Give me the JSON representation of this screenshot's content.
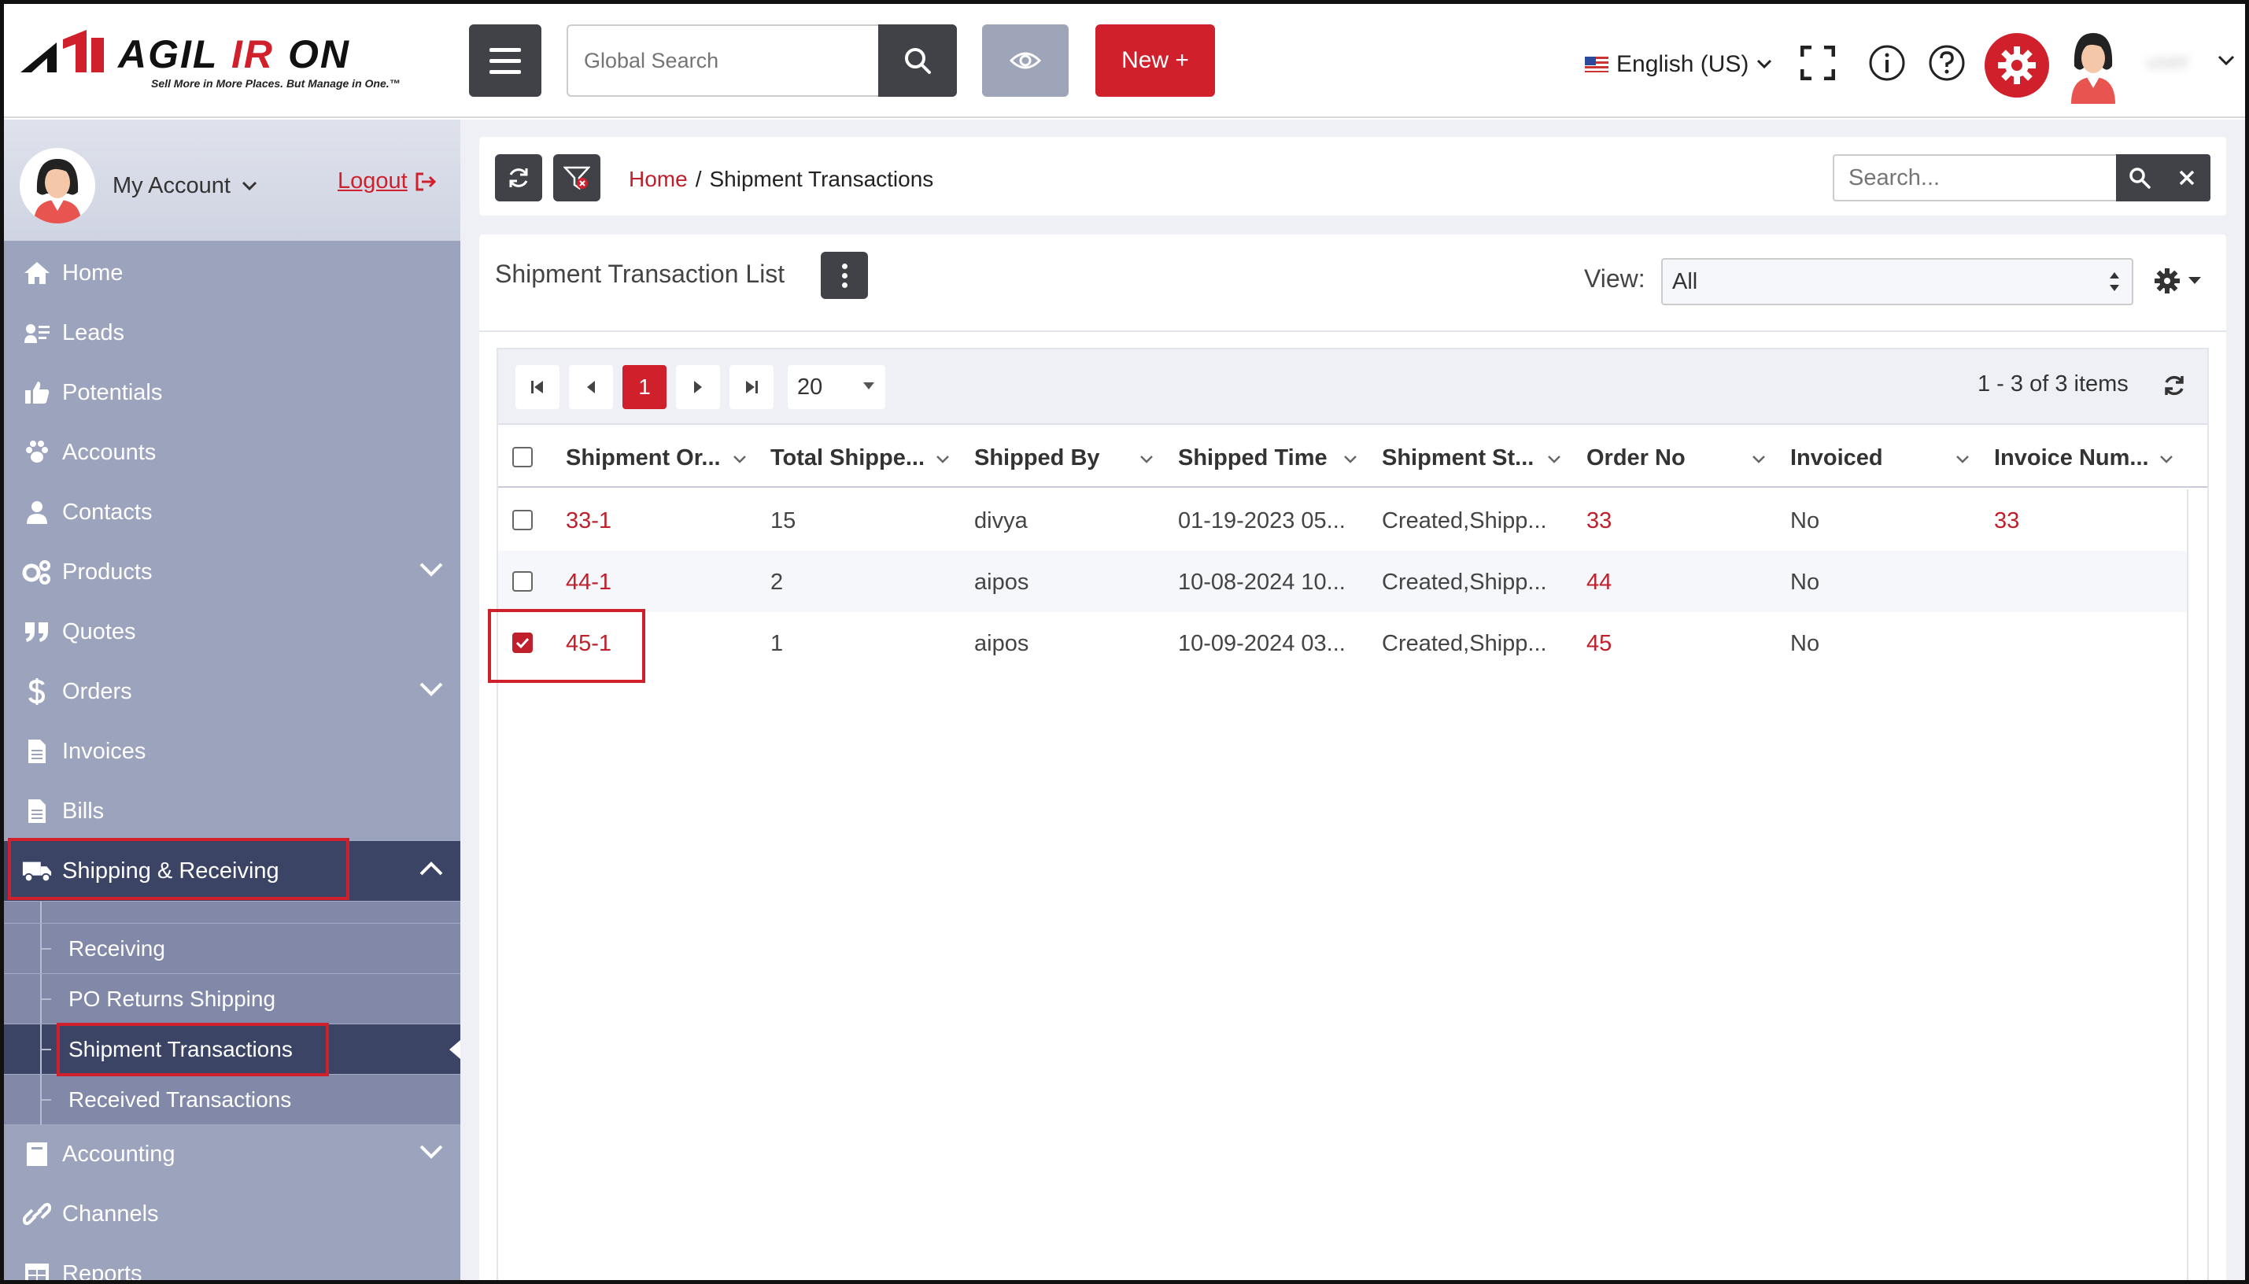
{
  "brand": {
    "logo_text": "AGILIRON",
    "tagline": "Sell More in More Places. But Manage in One.™"
  },
  "topbar": {
    "search_placeholder": "Global Search",
    "new_label": "New +",
    "language": "English (US)"
  },
  "sidebar": {
    "account_label": "My Account",
    "logout_label": "Logout",
    "items": [
      {
        "label": "Home",
        "icon": "home-icon"
      },
      {
        "label": "Leads",
        "icon": "leads-icon"
      },
      {
        "label": "Potentials",
        "icon": "thumbs-up-icon"
      },
      {
        "label": "Accounts",
        "icon": "paw-icon"
      },
      {
        "label": "Contacts",
        "icon": "user-icon"
      },
      {
        "label": "Products",
        "icon": "cogs-icon"
      },
      {
        "label": "Quotes",
        "icon": "quote-icon"
      },
      {
        "label": "Orders",
        "icon": "dollar-icon"
      },
      {
        "label": "Invoices",
        "icon": "document-icon"
      },
      {
        "label": "Bills",
        "icon": "document-icon"
      },
      {
        "label": "Shipping & Receiving",
        "icon": "truck-icon"
      },
      {
        "label": "Accounting",
        "icon": "book-icon"
      },
      {
        "label": "Channels",
        "icon": "link-icon"
      },
      {
        "label": "Reports",
        "icon": "table-icon"
      }
    ],
    "sub_items": [
      {
        "label": "Receiving"
      },
      {
        "label": "PO Returns Shipping"
      },
      {
        "label": "Shipment Transactions"
      },
      {
        "label": "Received Transactions"
      }
    ]
  },
  "breadcrumb": {
    "home": "Home",
    "separator": "/",
    "current": "Shipment Transactions"
  },
  "content_search": {
    "placeholder": "Search..."
  },
  "list": {
    "title": "Shipment Transaction List",
    "view_label": "View:",
    "view_value": "All",
    "page_current": "1",
    "page_size": "20",
    "items_info": "1 - 3 of 3 items",
    "columns": [
      "Shipment Or...",
      "Total Shippe...",
      "Shipped By",
      "Shipped Time",
      "Shipment St...",
      "Order No",
      "Invoiced",
      "Invoice Num..."
    ],
    "rows": [
      {
        "shipment_order": "33-1",
        "total_shipped": "15",
        "shipped_by": "divya",
        "shipped_time": "01-19-2023 05...",
        "status": "Created,Shipp...",
        "order_no": "33",
        "invoiced": "No",
        "invoice_num": "33",
        "checked": false
      },
      {
        "shipment_order": "44-1",
        "total_shipped": "2",
        "shipped_by": "aipos",
        "shipped_time": "10-08-2024 10...",
        "status": "Created,Shipp...",
        "order_no": "44",
        "invoiced": "No",
        "invoice_num": "",
        "checked": false
      },
      {
        "shipment_order": "45-1",
        "total_shipped": "1",
        "shipped_by": "aipos",
        "shipped_time": "10-09-2024 03...",
        "status": "Created,Shipp...",
        "order_no": "45",
        "invoiced": "No",
        "invoice_num": "",
        "checked": true
      }
    ]
  },
  "colors": {
    "accent": "#d0202b",
    "dark": "#404247",
    "sidebar": "#9ca4bd",
    "sidebar_active": "#3c4466"
  }
}
